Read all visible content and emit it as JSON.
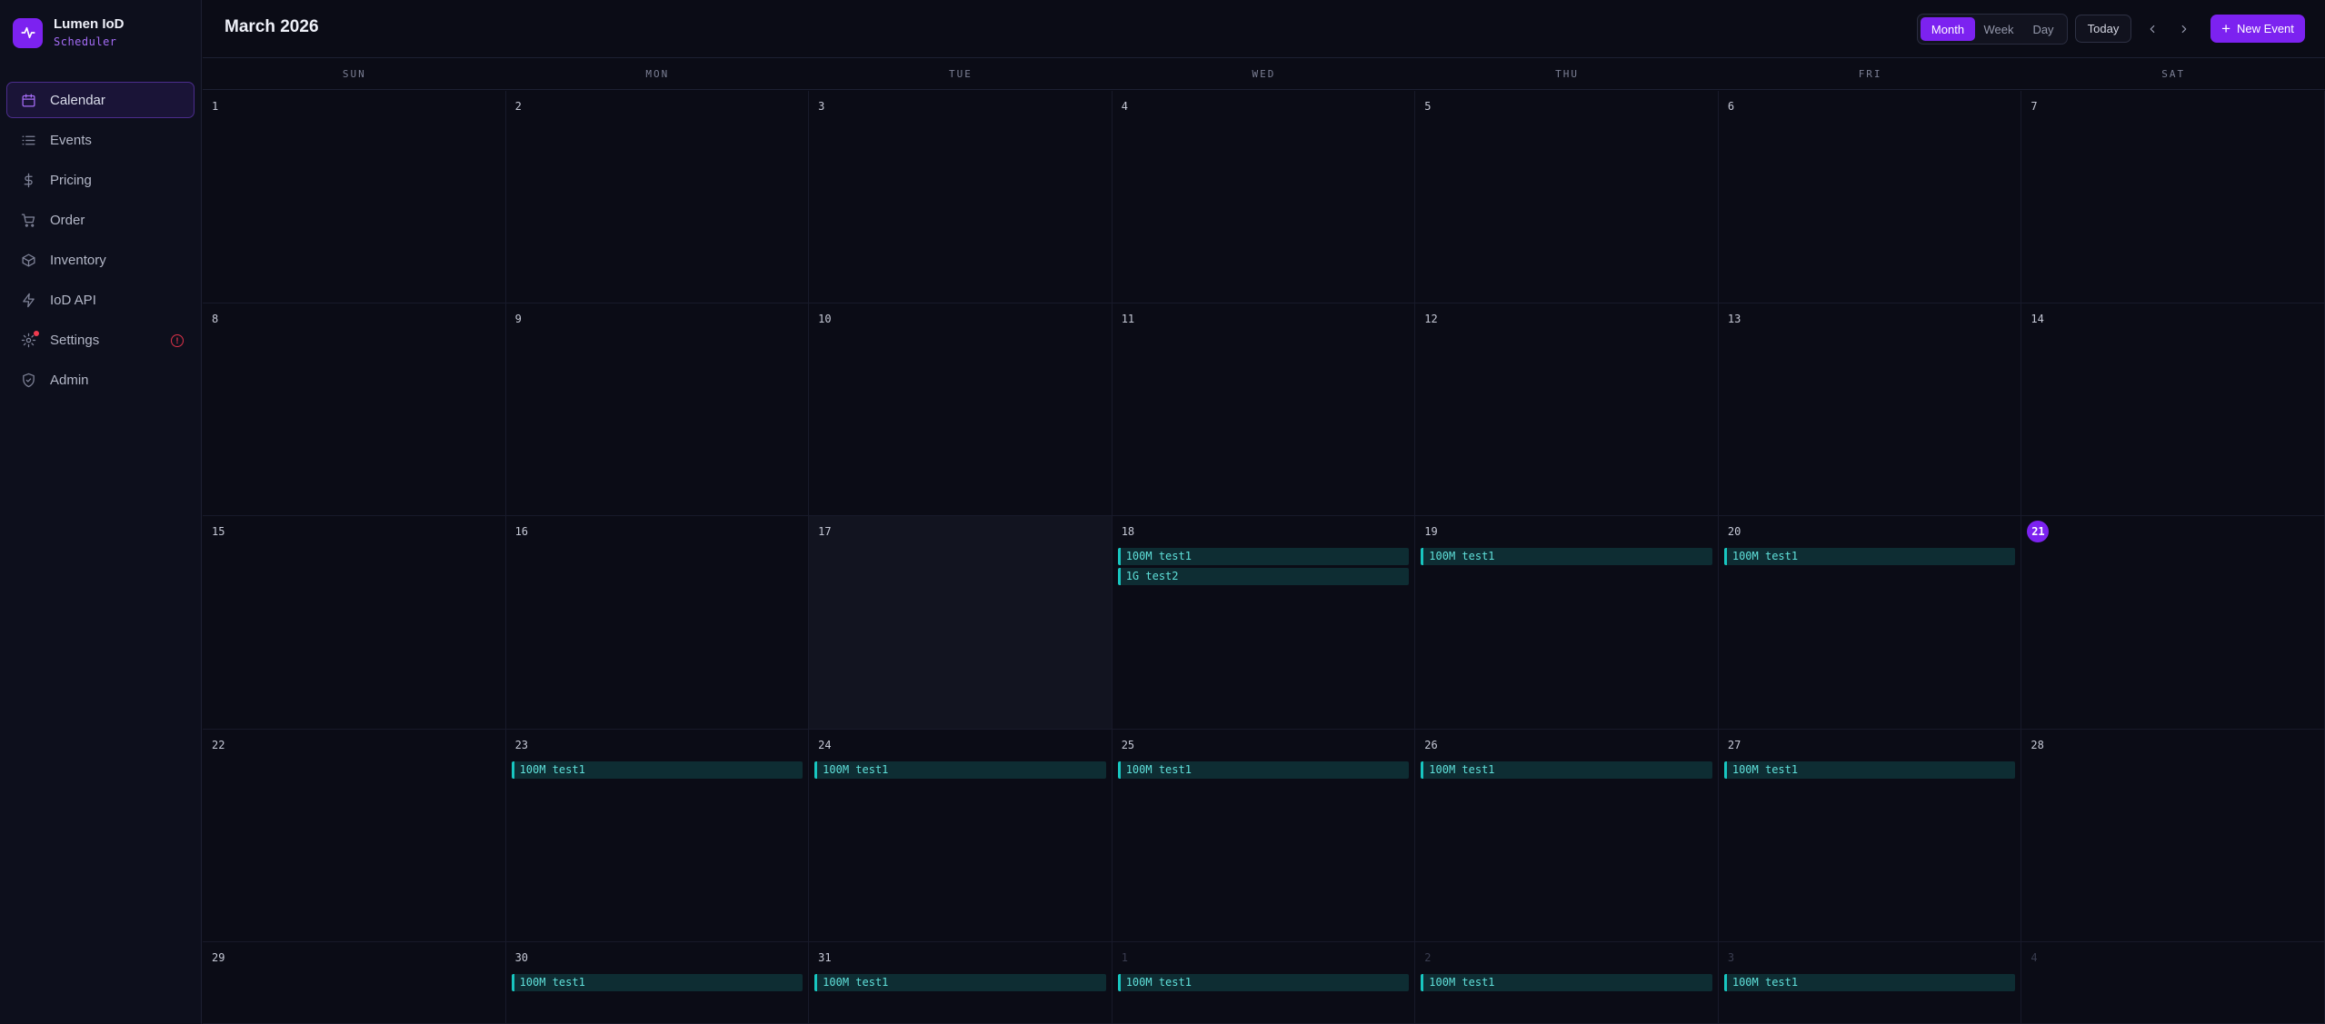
{
  "brand": {
    "name": "Lumen IoD",
    "subtitle": "Scheduler"
  },
  "sidebar": {
    "items": [
      {
        "label": "Calendar",
        "icon": "calendar-icon",
        "active": true
      },
      {
        "label": "Events",
        "icon": "list-icon"
      },
      {
        "label": "Pricing",
        "icon": "dollar-icon"
      },
      {
        "label": "Order",
        "icon": "cart-icon"
      },
      {
        "label": "Inventory",
        "icon": "box-icon"
      },
      {
        "label": "IoD API",
        "icon": "bolt-icon"
      },
      {
        "label": "Settings",
        "icon": "gear-icon",
        "notification_dot": true,
        "alert": "!"
      },
      {
        "label": "Admin",
        "icon": "shield-icon"
      }
    ]
  },
  "header": {
    "title": "March 2026",
    "views": [
      "Month",
      "Week",
      "Day"
    ],
    "active_view": "Month",
    "today_label": "Today",
    "prev_icon": "chevron-left-icon",
    "next_icon": "chevron-right-icon",
    "new_event_label": "New Event",
    "new_event_icon": "plus-icon"
  },
  "weekdays": [
    "SUN",
    "MON",
    "TUE",
    "WED",
    "THU",
    "FRI",
    "SAT"
  ],
  "calendar": {
    "today": "21",
    "selected": "17",
    "weeks": [
      [
        {
          "day": "1",
          "events": []
        },
        {
          "day": "2",
          "events": []
        },
        {
          "day": "3",
          "events": []
        },
        {
          "day": "4",
          "events": []
        },
        {
          "day": "5",
          "events": []
        },
        {
          "day": "6",
          "events": []
        },
        {
          "day": "7",
          "events": []
        }
      ],
      [
        {
          "day": "8",
          "events": []
        },
        {
          "day": "9",
          "events": []
        },
        {
          "day": "10",
          "events": []
        },
        {
          "day": "11",
          "events": []
        },
        {
          "day": "12",
          "events": []
        },
        {
          "day": "13",
          "events": []
        },
        {
          "day": "14",
          "events": []
        }
      ],
      [
        {
          "day": "15",
          "events": []
        },
        {
          "day": "16",
          "events": []
        },
        {
          "day": "17",
          "events": []
        },
        {
          "day": "18",
          "events": [
            "100M test1",
            "1G test2"
          ]
        },
        {
          "day": "19",
          "events": [
            "100M test1"
          ]
        },
        {
          "day": "20",
          "events": [
            "100M test1"
          ]
        },
        {
          "day": "21",
          "events": []
        }
      ],
      [
        {
          "day": "22",
          "events": []
        },
        {
          "day": "23",
          "events": [
            "100M test1"
          ]
        },
        {
          "day": "24",
          "events": [
            "100M test1"
          ]
        },
        {
          "day": "25",
          "events": [
            "100M test1"
          ]
        },
        {
          "day": "26",
          "events": [
            "100M test1"
          ]
        },
        {
          "day": "27",
          "events": [
            "100M test1"
          ]
        },
        {
          "day": "28",
          "events": []
        }
      ],
      [
        {
          "day": "29",
          "events": []
        },
        {
          "day": "30",
          "events": [
            "100M test1"
          ]
        },
        {
          "day": "31",
          "events": [
            "100M test1"
          ]
        },
        {
          "day": "1",
          "muted": true,
          "events": [
            "100M test1"
          ]
        },
        {
          "day": "2",
          "muted": true,
          "events": [
            "100M test1"
          ]
        },
        {
          "day": "3",
          "muted": true,
          "events": [
            "100M test1"
          ]
        },
        {
          "day": "4",
          "muted": true,
          "events": []
        }
      ]
    ]
  },
  "colors": {
    "accent": "#7c22f0",
    "event_border": "#18c6c0",
    "event_bg": "#0e2d33",
    "event_text": "#5fe0da",
    "alert": "#e0334a"
  }
}
